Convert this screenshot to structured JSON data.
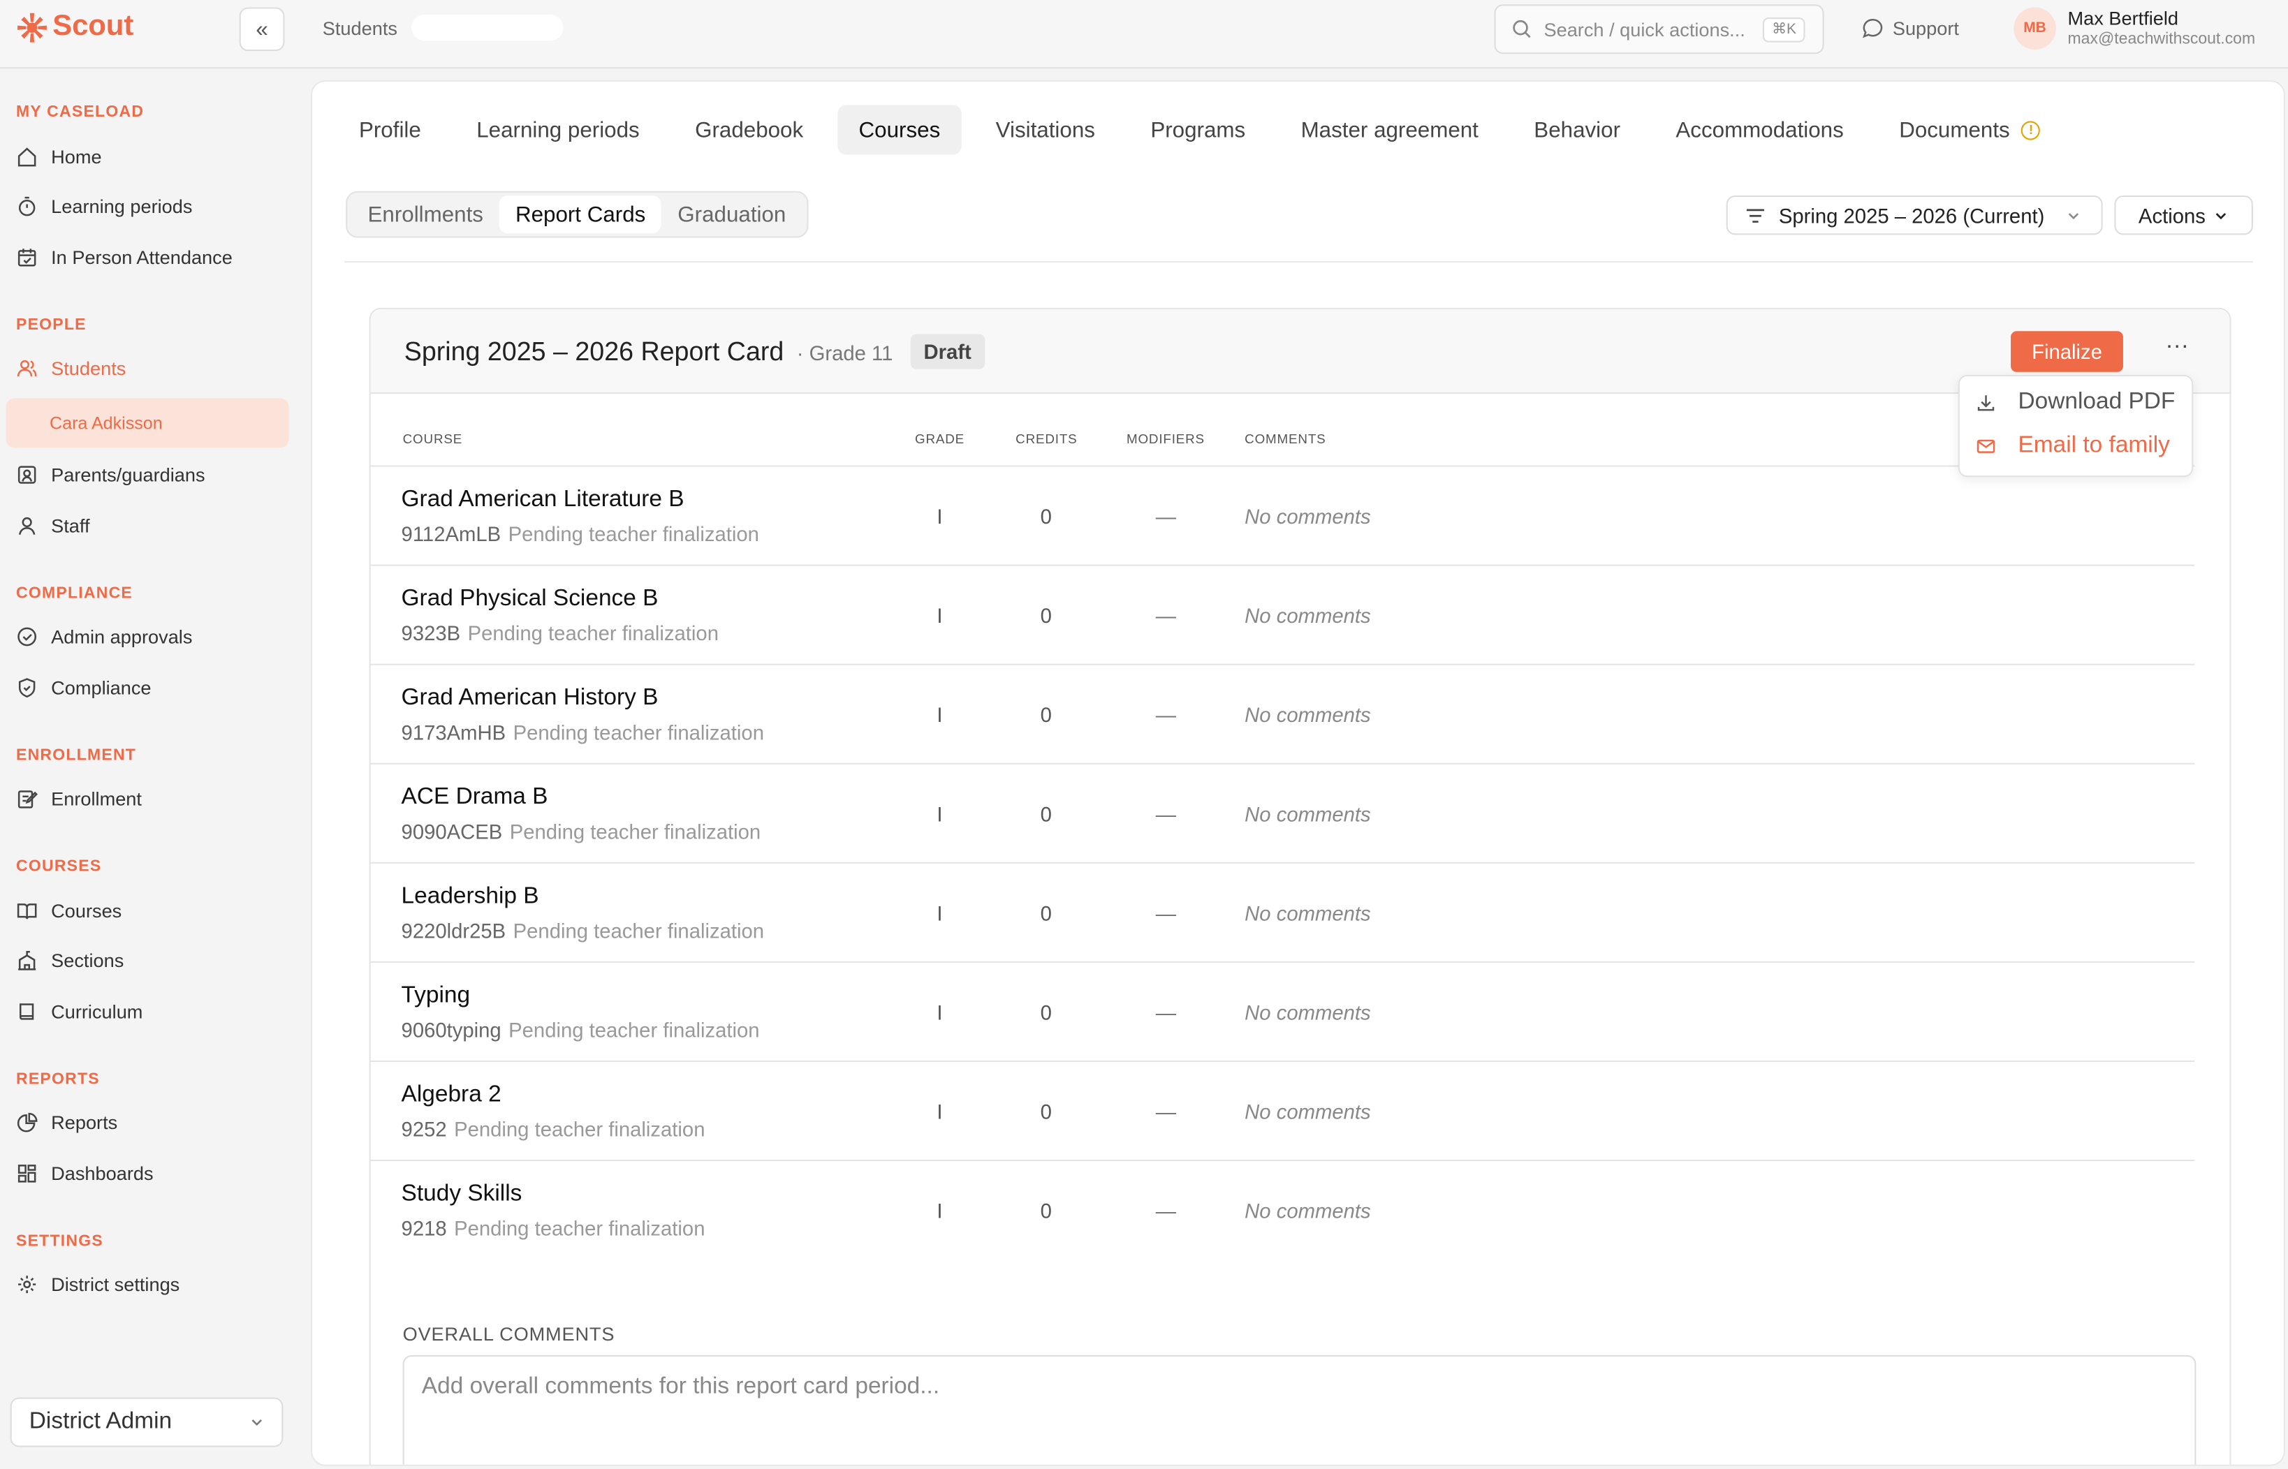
{
  "brand": {
    "name": "Scout",
    "accent": "#ef6a46"
  },
  "topbar": {
    "breadcrumb": "Students",
    "search_placeholder": "Search / quick actions...",
    "search_shortcut": "⌘K",
    "support_label": "Support",
    "user": {
      "initials": "MB",
      "name": "Max Bertfield",
      "email": "max@teachwithscout.com"
    }
  },
  "sidebar": {
    "caseload": {
      "title": "MY CASELOAD",
      "items": [
        "Home",
        "Learning periods",
        "In Person Attendance"
      ]
    },
    "people": {
      "title": "PEOPLE",
      "students": "Students",
      "student_sub": "Cara Adkisson",
      "parents": "Parents/guardians",
      "staff": "Staff"
    },
    "compliance": {
      "title": "COMPLIANCE",
      "items": [
        "Admin approvals",
        "Compliance"
      ]
    },
    "enrollment": {
      "title": "ENROLLMENT",
      "items": [
        "Enrollment"
      ]
    },
    "courses": {
      "title": "COURSES",
      "items": [
        "Courses",
        "Sections",
        "Curriculum"
      ]
    },
    "reports": {
      "title": "REPORTS",
      "items": [
        "Reports",
        "Dashboards"
      ]
    },
    "settings": {
      "title": "SETTINGS",
      "items": [
        "District settings"
      ]
    },
    "role": "District Admin"
  },
  "tabs": [
    "Profile",
    "Learning periods",
    "Gradebook",
    "Courses",
    "Visitations",
    "Programs",
    "Master agreement",
    "Behavior",
    "Accommodations",
    "Documents"
  ],
  "active_tab": "Courses",
  "subtabs": [
    "Enrollments",
    "Report Cards",
    "Graduation"
  ],
  "period_filter": "Spring 2025 – 2026 (Current)",
  "actions_label": "Actions",
  "report_card": {
    "title": "Spring 2025 – 2026 Report Card",
    "grade": "· Grade 11",
    "status": "Draft",
    "finalize_label": "Finalize",
    "more_label": "···",
    "columns": {
      "course": "COURSE",
      "grade": "GRADE",
      "credits": "CREDITS",
      "modifiers": "MODIFIERS",
      "comments": "COMMENTS"
    },
    "rows": [
      {
        "name": "Grad American Literature B",
        "code": "9112AmLB",
        "status": "Pending teacher finalization",
        "grade": "I",
        "credits": "0",
        "modifiers": "—",
        "comments": "No comments"
      },
      {
        "name": "Grad Physical Science B",
        "code": "9323B",
        "status": "Pending teacher finalization",
        "grade": "I",
        "credits": "0",
        "modifiers": "—",
        "comments": "No comments"
      },
      {
        "name": "Grad American History B",
        "code": "9173AmHB",
        "status": "Pending teacher finalization",
        "grade": "I",
        "credits": "0",
        "modifiers": "—",
        "comments": "No comments"
      },
      {
        "name": "ACE Drama B",
        "code": "9090ACEB",
        "status": "Pending teacher finalization",
        "grade": "I",
        "credits": "0",
        "modifiers": "—",
        "comments": "No comments"
      },
      {
        "name": "Leadership B",
        "code": "9220ldr25B",
        "status": "Pending teacher finalization",
        "grade": "I",
        "credits": "0",
        "modifiers": "—",
        "comments": "No comments"
      },
      {
        "name": "Typing",
        "code": "9060typing",
        "status": "Pending teacher finalization",
        "grade": "I",
        "credits": "0",
        "modifiers": "—",
        "comments": "No comments"
      },
      {
        "name": "Algebra 2",
        "code": "9252",
        "status": "Pending teacher finalization",
        "grade": "I",
        "credits": "0",
        "modifiers": "—",
        "comments": "No comments"
      },
      {
        "name": "Study Skills",
        "code": "9218",
        "status": "Pending teacher finalization",
        "grade": "I",
        "credits": "0",
        "modifiers": "—",
        "comments": "No comments"
      }
    ],
    "overall_label": "OVERALL COMMENTS",
    "overall_placeholder": "Add overall comments for this report card period..."
  },
  "menu": {
    "download": "Download PDF",
    "email": "Email to family"
  }
}
